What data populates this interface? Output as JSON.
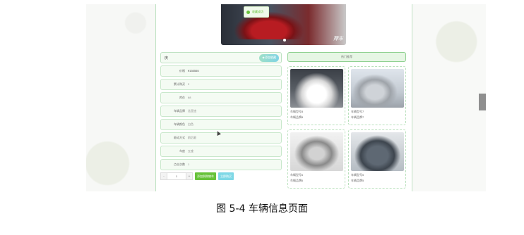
{
  "toast": {
    "text": "收藏成功"
  },
  "banner": {
    "watermark": "萍车"
  },
  "vehicle": {
    "title": "庆",
    "collect_label": "★添加收藏",
    "fields": [
      {
        "label": "价格",
        "value": "¥155555"
      },
      {
        "label": "累计购买",
        "value": "2"
      },
      {
        "label": "库存",
        "value": "68"
      },
      {
        "label": "车辆品牌",
        "value": "比亚迪"
      },
      {
        "label": "车辆颜色",
        "value": "白色"
      },
      {
        "label": "驱动方式",
        "value": "前后驱"
      },
      {
        "label": "车座",
        "value": "五座"
      },
      {
        "label": "点击次数",
        "value": "1"
      }
    ]
  },
  "purchase": {
    "minus": "-",
    "quantity": "1",
    "plus": "+",
    "add_cart_label": "添加到购物车",
    "buy_now_label": "立即购买"
  },
  "hot": {
    "title": "热门推荐",
    "cards": [
      {
        "line1": "车辆型号8",
        "line2": "车辆品牌8"
      },
      {
        "line1": "车辆型号7",
        "line2": "车辆品牌7"
      },
      {
        "line1": "车辆型号6",
        "line2": "车辆品牌6"
      },
      {
        "line1": "车辆型号5",
        "line2": "车辆品牌5"
      }
    ]
  },
  "caption": "图 5-4 车辆信息页面",
  "colors": {
    "accent_green": "#67c23a",
    "border_green": "#bfe2c3",
    "accent_cyan": "#7fd8e6"
  }
}
